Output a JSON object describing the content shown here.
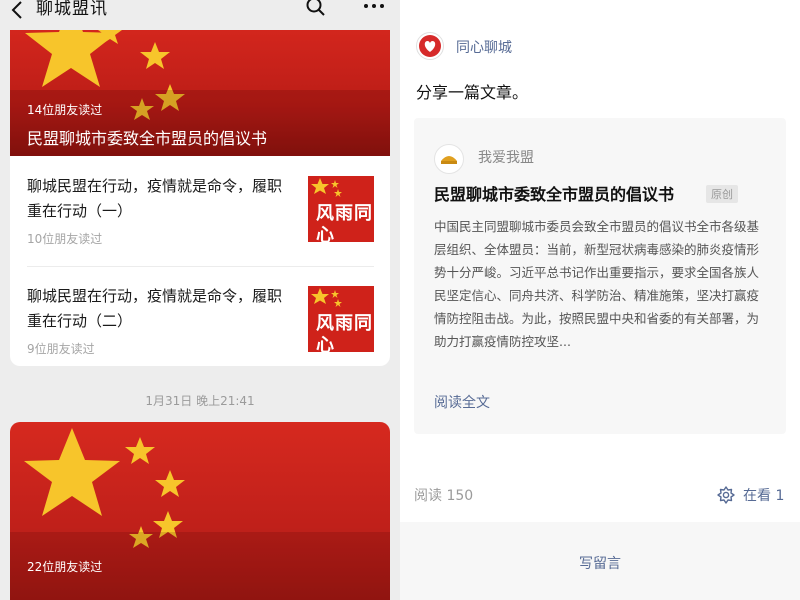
{
  "left": {
    "topbar": {
      "title": "聊城盟讯"
    },
    "featured": {
      "readers": "14位朋友读过",
      "title": "民盟聊城市委致全市盟员的倡议书"
    },
    "items": [
      {
        "title": "聊城民盟在行动，疫情就是命令，履职重在行动（一）",
        "readers": "10位朋友读过",
        "thumb_text": "风雨同心"
      },
      {
        "title": "聊城民盟在行动，疫情就是命令，履职重在行动（二）",
        "readers": "9位朋友读过",
        "thumb_text": "风雨同心"
      }
    ],
    "timestamp": "1月31日 晚上21:41",
    "second_card": {
      "readers": "22位朋友读过"
    }
  },
  "right": {
    "account_name": "同心聊城",
    "share_text": "分享一篇文章。",
    "article": {
      "source": "我爱我盟",
      "title": "民盟聊城市委致全市盟员的倡议书",
      "tag": "原创",
      "summary": "中国民主同盟聊城市委员会致全市盟员的倡议书全市各级基层组织、全体盟员：当前，新型冠状病毒感染的肺炎疫情形势十分严峻。习近平总书记作出重要指示，要求全国各族人民坚定信心、同舟共济、科学防治、精准施策，坚决打赢疫情防控阻击战。为此，按照民盟中央和省委的有关部署，为助力打赢疫情防控攻坚...",
      "read_full": "阅读全文"
    },
    "read_count": "阅读 150",
    "zaikan": "在看 1",
    "comment_button": "写留言"
  },
  "colors": {
    "flag_red": "#c7221b",
    "star_yellow": "#f7c52b",
    "link_blue": "#576b95"
  },
  "icons": [
    "back-icon",
    "search-icon",
    "more-icon",
    "zaikan-icon"
  ]
}
